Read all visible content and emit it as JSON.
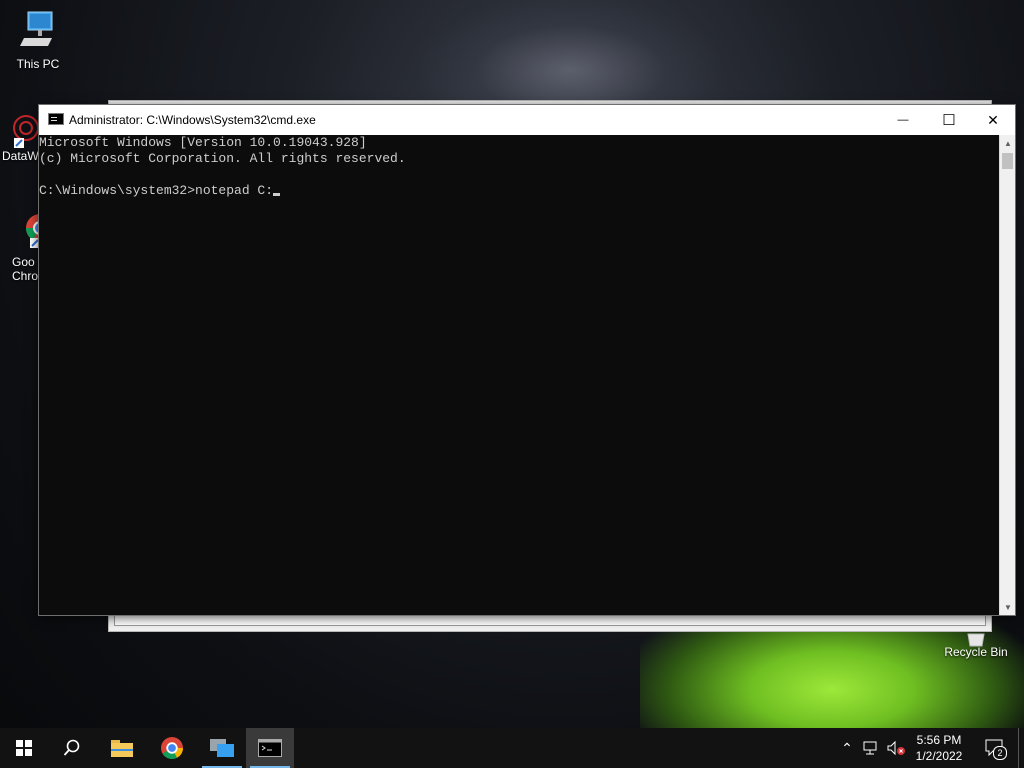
{
  "desktop": {
    "icons": [
      {
        "label": "This PC",
        "icon": "computer-icon"
      },
      {
        "label": "DataW",
        "icon": "datawrapper-icon"
      },
      {
        "label": "Goo Chro",
        "label_line1": "Goo",
        "label_line2": "Chro",
        "icon": "chrome-icon"
      },
      {
        "label": "Recycle Bin",
        "icon": "recycle-bin-icon"
      }
    ]
  },
  "cmd_window": {
    "title": "Administrator: C:\\Windows\\System32\\cmd.exe",
    "lines": [
      "Microsoft Windows [Version 10.0.19043.928]",
      "(c) Microsoft Corporation. All rights reserved.",
      "",
      "C:\\Windows\\system32>notepad C:"
    ],
    "buttons": {
      "minimize": "—",
      "maximize": "☐",
      "close": "✕"
    }
  },
  "taskbar": {
    "items": [
      "start-icon",
      "search-icon",
      "file-explorer-icon",
      "chrome-icon",
      "task-view-icon",
      "cmd-icon"
    ],
    "clock_time": "5:56 PM",
    "clock_date": "1/2/2022",
    "notification_count": "2",
    "colors": {
      "accent": "#76b9ed",
      "background": "#121212"
    }
  }
}
